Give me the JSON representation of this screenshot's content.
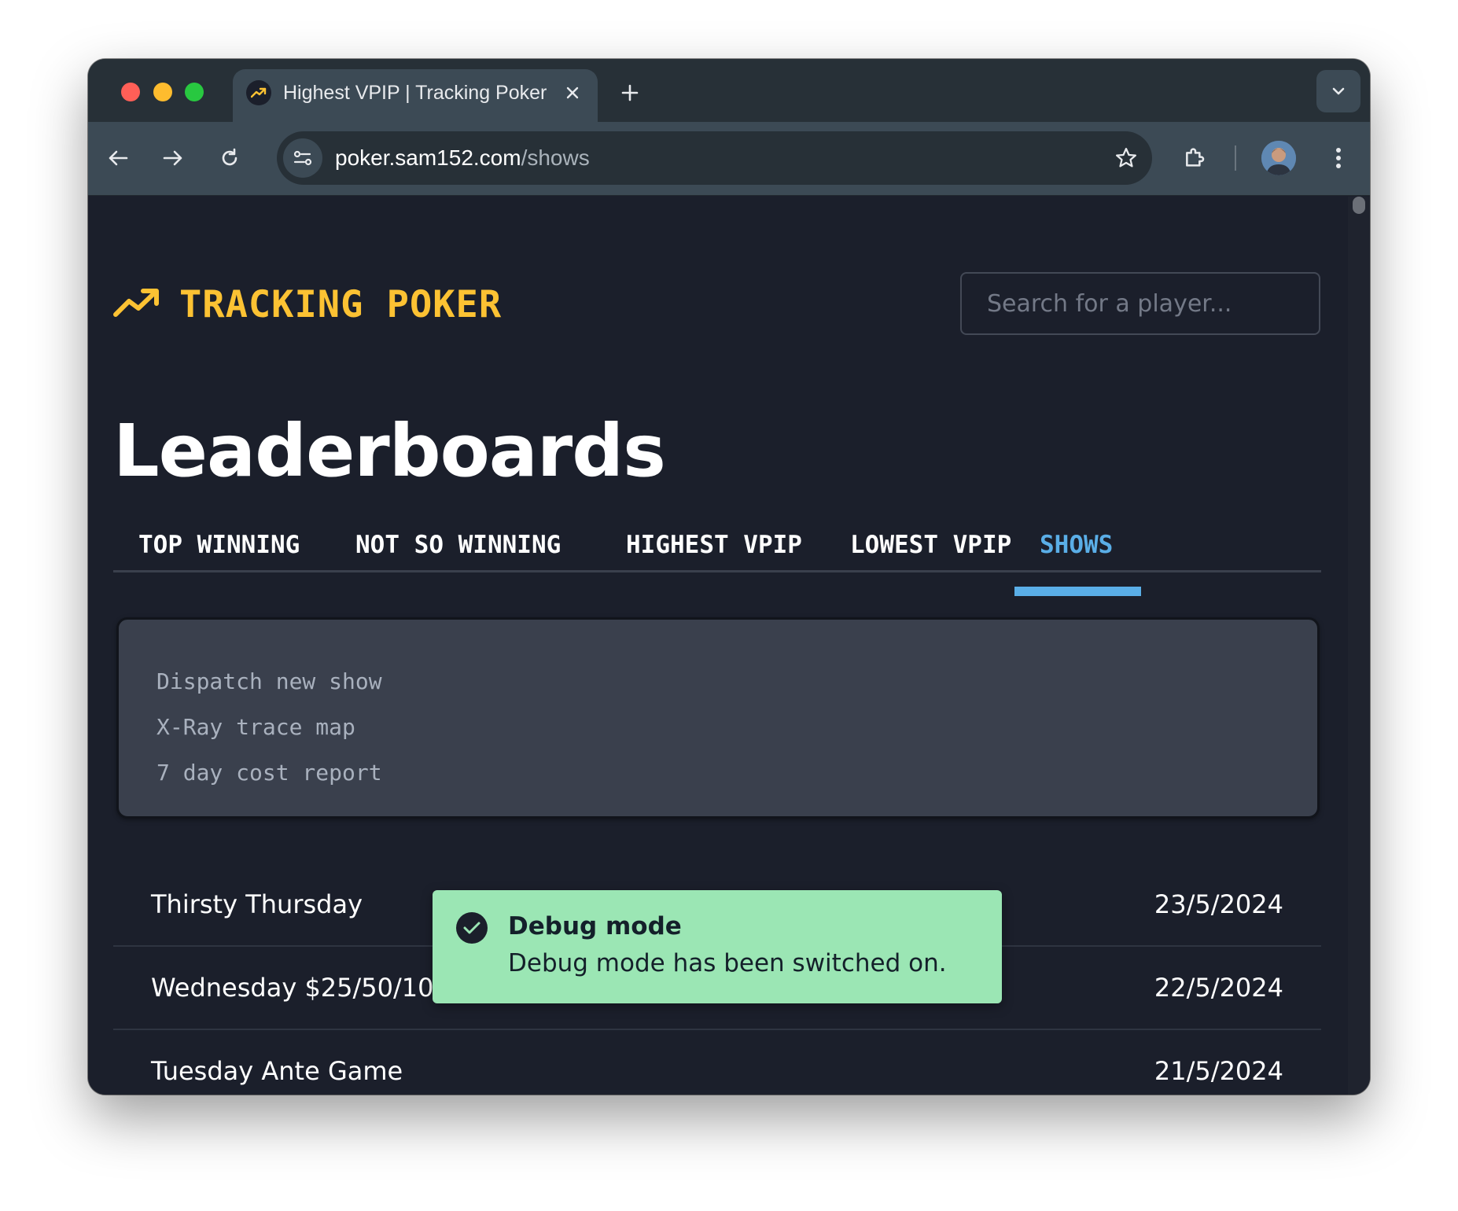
{
  "browser": {
    "tab": {
      "title": "Highest VPIP | Tracking Poker",
      "close_icon": "close-icon",
      "favicon": "trending-up-icon"
    },
    "new_tab_icon": "plus-icon",
    "tabs_dropdown_icon": "chevron-down-icon",
    "nav": {
      "back_icon": "arrow-left-icon",
      "forward_icon": "arrow-right-icon",
      "reload_icon": "reload-icon"
    },
    "url": {
      "host": "poker.sam152.com",
      "path": "/shows"
    },
    "bookmark_icon": "star-icon",
    "extensions_icon": "puzzle-icon",
    "menu_icon": "kebab-menu-icon",
    "traffic_lights": [
      "#ff5f57",
      "#febc2e",
      "#28c840"
    ]
  },
  "header": {
    "logo_text": "TRACKING POKER",
    "logo_icon": "trending-up-icon",
    "search_placeholder": "Search for a player..."
  },
  "page": {
    "title": "Leaderboards"
  },
  "tabs": [
    {
      "label": "TOP WINNING",
      "active": false
    },
    {
      "label": "NOT SO WINNING",
      "active": false
    },
    {
      "label": "HIGHEST VPIP",
      "active": false
    },
    {
      "label": "LOWEST VPIP",
      "active": false
    },
    {
      "label": "SHOWS",
      "active": true
    }
  ],
  "debug_panel": {
    "links": [
      "Dispatch new show",
      "X-Ray trace map",
      "7 day cost report"
    ]
  },
  "shows": [
    {
      "name": "Thirsty Thursday",
      "date": "23/5/2024"
    },
    {
      "name": "Wednesday $25/50/100",
      "date": "22/5/2024"
    },
    {
      "name": "Tuesday Ante Game",
      "date": "21/5/2024"
    }
  ],
  "toast": {
    "title": "Debug mode",
    "message": "Debug mode has been switched on.",
    "icon": "check-circle-icon"
  },
  "colors": {
    "accent_yellow": "#fcc233",
    "accent_blue": "#5aaee7",
    "page_bg": "#1b1f2b",
    "toast_bg": "#9be6b4"
  }
}
